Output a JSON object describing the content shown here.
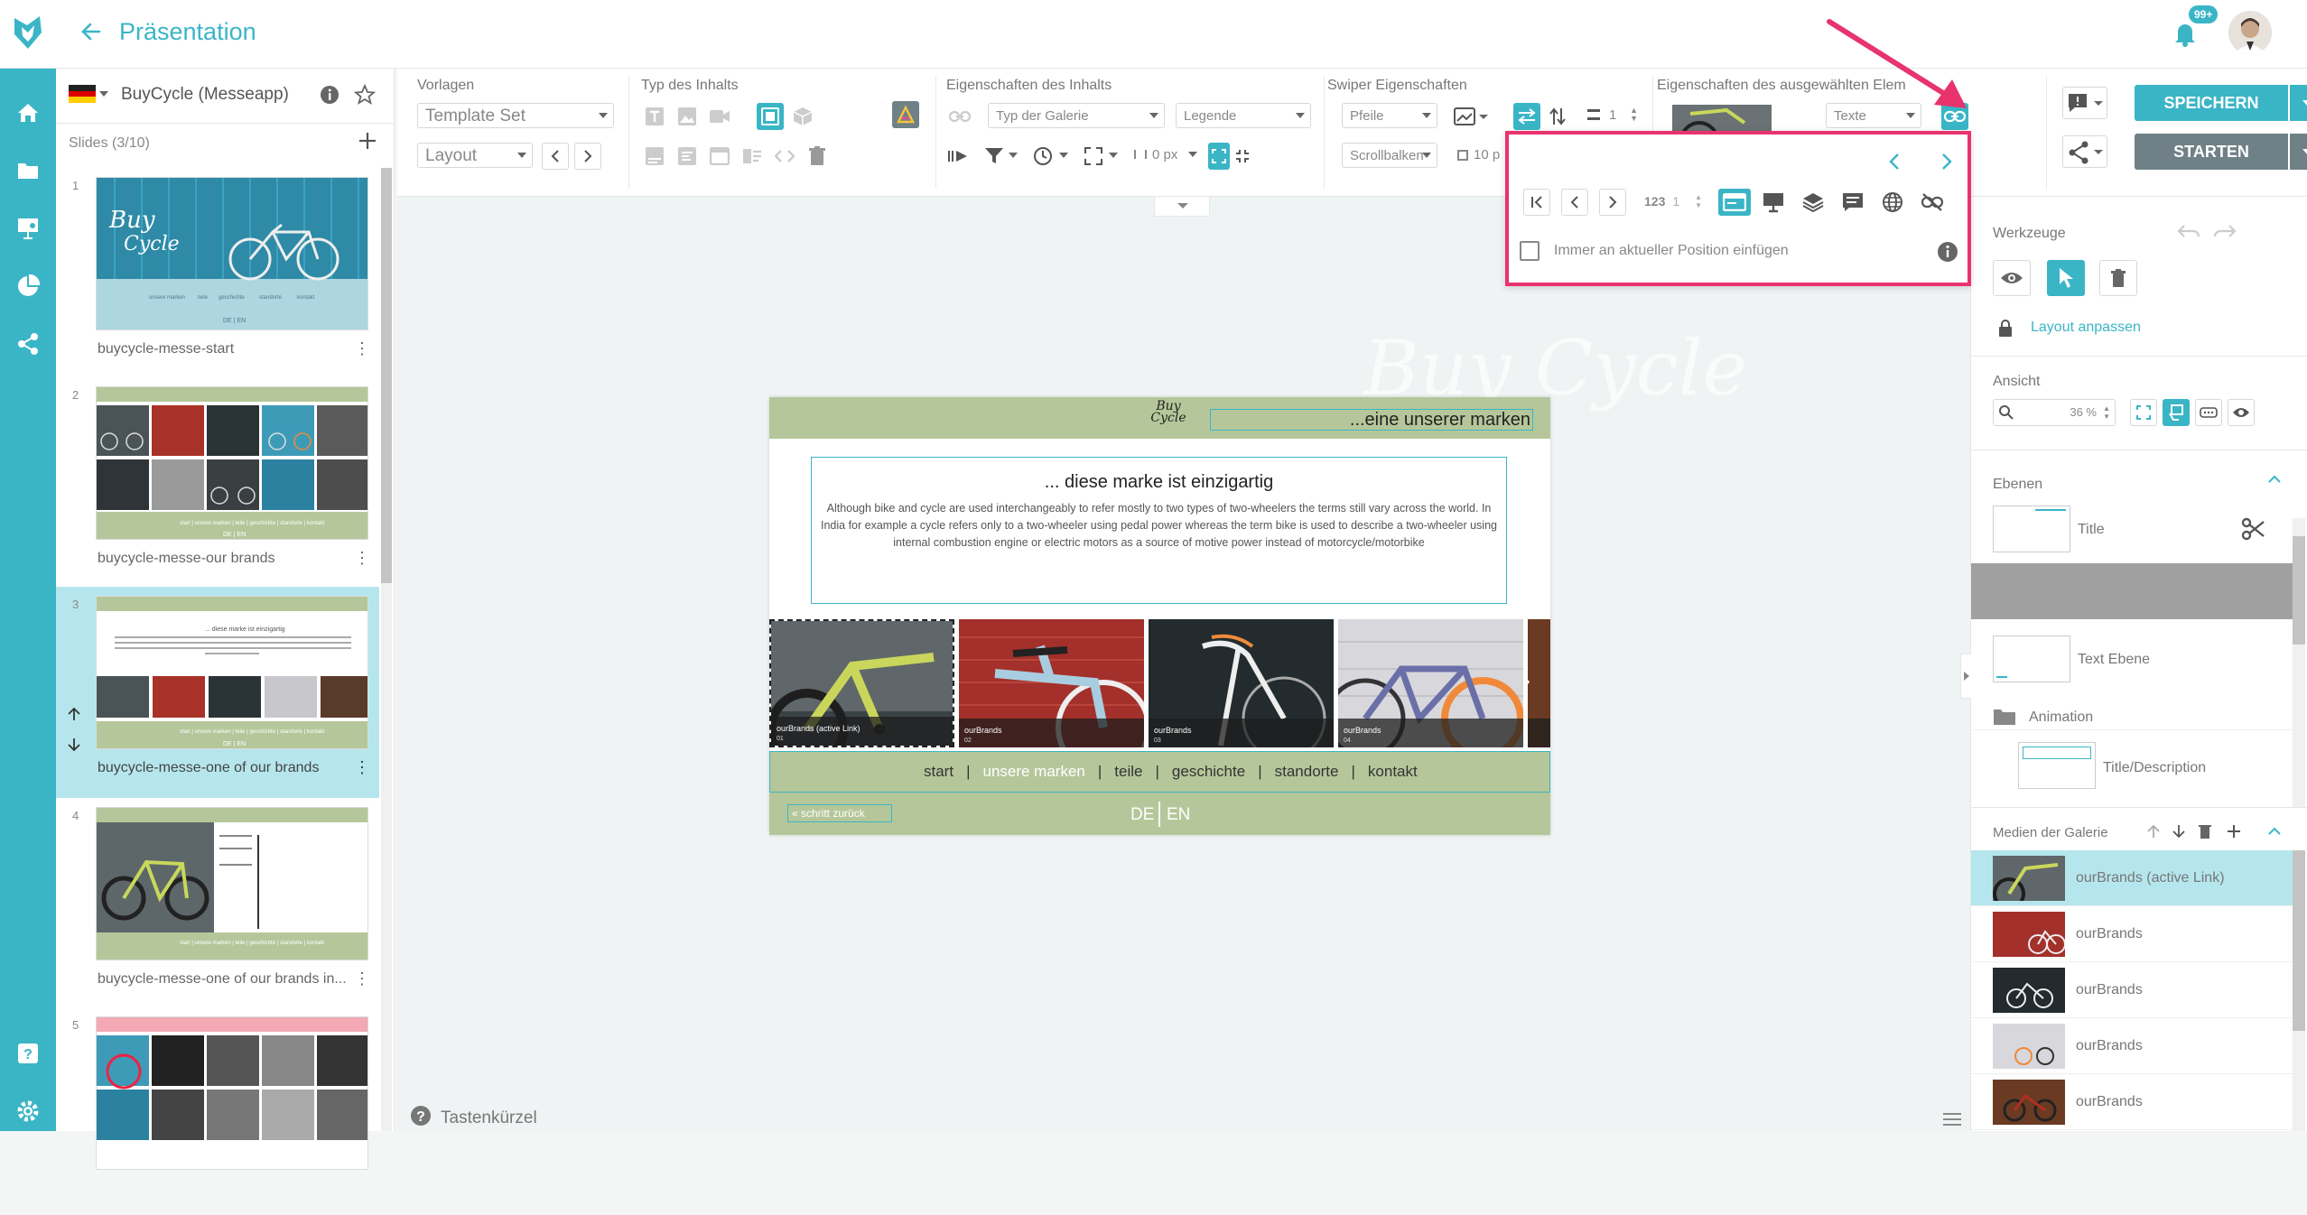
{
  "header": {
    "title": "Präsentation",
    "notification_count": "99+"
  },
  "slides_panel": {
    "project_title": "BuyCycle (Messeapp)",
    "count_label": "Slides (3/10)",
    "slides": [
      {
        "num": "1",
        "name": "buycycle-messe-start"
      },
      {
        "num": "2",
        "name": "buycycle-messe-our brands"
      },
      {
        "num": "3",
        "name": "buycycle-messe-one of our brands"
      },
      {
        "num": "4",
        "name": "buycycle-messe-one of our brands in..."
      },
      {
        "num": "5",
        "name": ""
      }
    ]
  },
  "toolbar": {
    "vorlagen": {
      "label": "Vorlagen",
      "template_set": "Template Set",
      "layout": "Layout"
    },
    "typ": {
      "label": "Typ des Inhalts"
    },
    "eigenschaften": {
      "label": "Eigenschaften des Inhalts",
      "typ_galerie": "Typ der Galerie",
      "legende": "Legende",
      "px_value": "0 px"
    },
    "swiper": {
      "label": "Swiper Eigenschaften",
      "pfeile": "Pfeile",
      "scrollbalken": "Scrollbalken",
      "count": "1",
      "size": "10 p"
    },
    "ausgewaehlt": {
      "label": "Eigenschaften des ausgewählten Elem",
      "texte": "Texte"
    },
    "save_label": "SPEICHERN",
    "start_label": "STARTEN"
  },
  "popup": {
    "page_value": "1",
    "num_label": "123",
    "checkbox_label": "Immer an aktueller Position einfügen"
  },
  "stage": {
    "logo_text": "Buy Cycle",
    "header_text": "...eine unserer marken",
    "headline": "... diese marke ist einzigartig",
    "body": "Although bike and cycle are used interchangeably to refer mostly to two types of two-wheelers the terms still vary across the world. In India for example a cycle refers only to a two-wheeler using pedal power whereas the term bike is used to describe a two-wheeler using internal combustion engine or electric motors as a source of motive power instead of motorcycle/motorbike",
    "gallery": [
      {
        "caption": "ourBrands (active Link)",
        "sub": "01"
      },
      {
        "caption": "ourBrands",
        "sub": "02"
      },
      {
        "caption": "ourBrands",
        "sub": "03"
      },
      {
        "caption": "ourBrands",
        "sub": "04"
      }
    ],
    "nav": [
      "start",
      "unsere marken",
      "teile",
      "geschichte",
      "standorte",
      "kontakt"
    ],
    "back_link": "« schritt zurück",
    "lang_de": "DE",
    "lang_en": "EN"
  },
  "right_panel": {
    "werkzeuge": "Werkzeuge",
    "layout_anpassen": "Layout anpassen",
    "ansicht": "Ansicht",
    "zoom": "36 %",
    "ebenen": "Ebenen",
    "layers": [
      "Title",
      "",
      "Text Ebene",
      "Animation",
      "Title/Description"
    ],
    "medien": "Medien der Galerie",
    "media": [
      "ourBrands (active Link)",
      "ourBrands",
      "ourBrands",
      "ourBrands",
      "ourBrands"
    ]
  },
  "footer": {
    "shortcuts": "Tastenkürzel"
  },
  "colors": {
    "accent": "#3ab5c6",
    "highlight": "#e8336e",
    "sage": "#b5c79a",
    "dark_button": "#6f8187"
  }
}
